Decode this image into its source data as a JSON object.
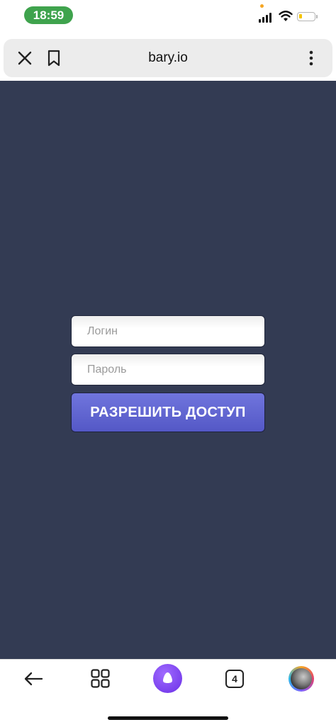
{
  "status_bar": {
    "time": "18:59",
    "time_pill_color": "#3fa34d",
    "icons": [
      "signal-icon",
      "wifi-icon",
      "battery-icon"
    ],
    "battery_level_fraction": 0.15
  },
  "browser": {
    "url": "bary.io",
    "icons": [
      "close-icon",
      "bookmark-icon",
      "more-vertical-icon"
    ]
  },
  "login_form": {
    "login_placeholder": "Логин",
    "login_value": "",
    "password_placeholder": "Пароль",
    "password_value": "",
    "submit_label": "РАЗРЕШИТЬ ДОСТУП",
    "background_color": "#333b53",
    "button_color": "#5c61cf"
  },
  "bottom_nav": {
    "icons": [
      "back-arrow-icon",
      "grid-icon",
      "alice-icon",
      "tabs-icon",
      "avatar"
    ],
    "tabs_count": "4",
    "alice_color": "#7b3ff2"
  }
}
